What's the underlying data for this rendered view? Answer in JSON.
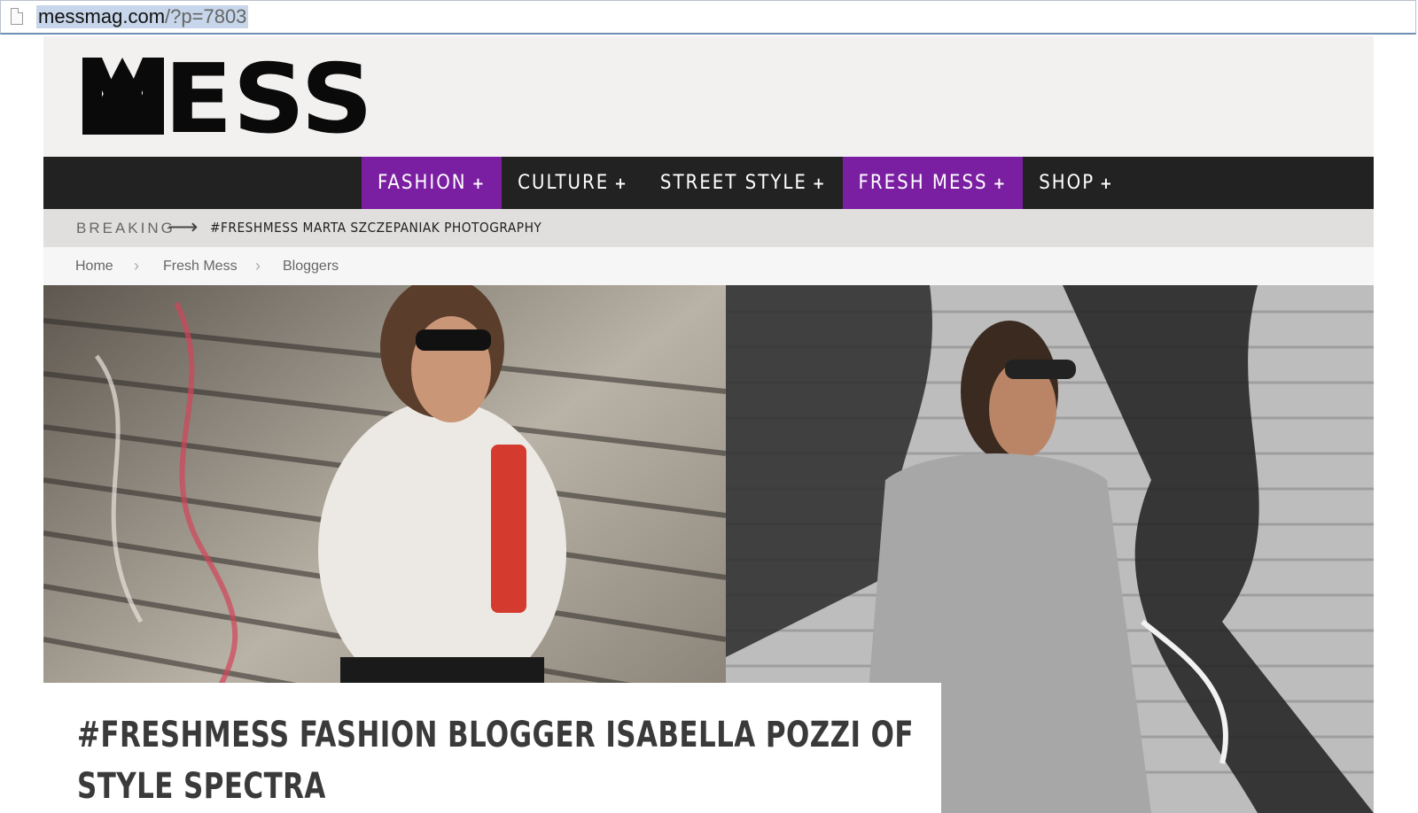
{
  "browser": {
    "url_host": "messmag.com",
    "url_path": "/?p=7803"
  },
  "site": {
    "logo_text": "MESS"
  },
  "nav": {
    "items": [
      {
        "label": "FASHION",
        "active": true
      },
      {
        "label": "CULTURE",
        "active": false
      },
      {
        "label": "STREET STYLE",
        "active": false
      },
      {
        "label": "FRESH MESS",
        "active": true
      },
      {
        "label": "SHOP",
        "active": false
      }
    ],
    "plus_glyph": "+",
    "active_color": "#7b1fa2"
  },
  "breaking": {
    "label": "BREAKING",
    "arrow": "⟶",
    "headline": "#FRESHMESS MARTA SZCZEPANIAK PHOTOGRAPHY"
  },
  "breadcrumb": {
    "items": [
      "Home",
      "Fresh Mess",
      "Bloggers"
    ],
    "separator": "›"
  },
  "article": {
    "title": "#FRESHMESS FASHION BLOGGER ISABELLA POZZI OF STYLE SPECTRA"
  }
}
